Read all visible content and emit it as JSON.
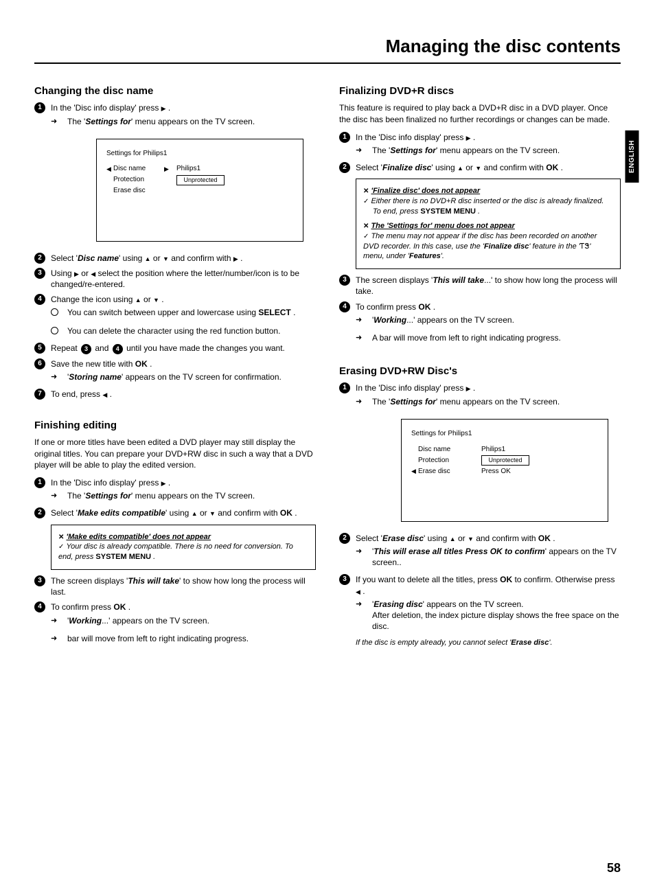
{
  "page_title": "Managing the disc contents",
  "side_tab": "ENGLISH",
  "page_number": "58",
  "sections": {
    "change_name": {
      "title": "Changing the disc name",
      "step1": "In the 'Disc info display' press ",
      "step1_result_a": "The '",
      "step1_result_b": "Settings for",
      "step1_result_c": "' menu appears on the TV screen.",
      "panel": {
        "title": "Settings for Philips1",
        "r1_key": "Disc name",
        "r1_val": "Philips1",
        "r2_key": "Protection",
        "r2_val": "Unprotected",
        "r3_key": "Erase disc"
      },
      "step2_a": "Select '",
      "step2_b": "Disc name",
      "step2_c": "' using ",
      "step2_d": " or ",
      "step2_e": " and confirm with ",
      "step3_a": "Using ",
      "step3_b": " or ",
      "step3_c": " select the position where the letter/number/icon is to be changed/re-entered.",
      "step4_a": "Change the icon using ",
      "step4_b": " or ",
      "step4_sub1_a": "You can switch between upper and lowercase using ",
      "step4_sub1_b": "SELECT",
      "step4_sub2": "You can delete the character using the red function button.",
      "step5": "Repeat ",
      "step5_mid": " and ",
      "step5_end": " until you have made the changes you want.",
      "step6_a": "Save the new title with ",
      "step6_b": "OK",
      "step6_result_a": "'",
      "step6_result_b": "Storing name",
      "step6_result_c": "' appears on the TV screen for confirmation.",
      "step7": "To end, press "
    },
    "finish_edit": {
      "title": "Finishing editing",
      "intro": "If one or more titles have been edited a DVD player may still display the original titles. You can prepare your DVD+RW disc in such a way that a DVD player will be able to play the edited version.",
      "step1": "In the 'Disc info display' press ",
      "step1_result_a": "The '",
      "step1_result_b": "Settings for",
      "step1_result_c": "' menu appears on the TV screen.",
      "step2_a": "Select '",
      "step2_b": "Make edits compatible",
      "step2_c": "' using ",
      "step2_d": " or ",
      "step2_e": " and confirm with ",
      "step2_f": "OK",
      "note_hdr": "'Make edits compatible' does not appear",
      "note_body_a": "Your disc is already compatible. There is no need for conversion. To end, press ",
      "note_body_b": "SYSTEM MENU",
      "step3_a": "The screen displays '",
      "step3_b": "This will take",
      "step3_c": "' to show how long the process will last.",
      "step4_a": "To confirm press ",
      "step4_b": "OK",
      "step4_res_a": "'",
      "step4_res_b": "Working",
      "step4_res_c": "...' appears on the TV screen.",
      "step4_res2": "bar will move from left to right indicating progress."
    },
    "finalize": {
      "title": "Finalizing DVD+R discs",
      "intro": "This feature is required to play back a DVD+R disc in a DVD player. Once the disc has been finalized no further recordings or changes can be made.",
      "step1": "In the 'Disc info display' press ",
      "step1_result_a": "The '",
      "step1_result_b": "Settings for",
      "step1_result_c": "' menu appears on the TV screen.",
      "step2_a": "Select '",
      "step2_b": "Finalize disc",
      "step2_c": "' using ",
      "step2_d": " or ",
      "step2_e": " and confirm with ",
      "step2_f": "OK",
      "note1_hdr": "'Finalize disc' does not appear",
      "note1_body": "Either there is no DVD+R disc inserted or the disc is already finalized.",
      "note1_end_a": "To end, press ",
      "note1_end_b": "SYSTEM MENU",
      "note2_hdr": "The 'Settings for' menu does not appear",
      "note2_body_a": "The menu may not appear if the disc has been recorded on another DVD recorder. In this case, use the '",
      "note2_body_b": "Finalize disc",
      "note2_body_c": "' feature in the '",
      "note2_body_d": "' menu, under '",
      "note2_body_e": "Features",
      "note2_body_f": "'.",
      "step3_a": "The screen displays '",
      "step3_b": "This will take",
      "step3_c": "...' to show how long the process will take.",
      "step4_a": "To confirm press ",
      "step4_b": "OK",
      "step4_res_a": "'",
      "step4_res_b": "Working",
      "step4_res_c": "...' appears on the TV screen.",
      "step4_res2": "A bar will move from left to right indicating progress."
    },
    "erase": {
      "title": "Erasing DVD+RW Disc's",
      "step1": "In the 'Disc info display' press ",
      "step1_result_a": "The '",
      "step1_result_b": "Settings for",
      "step1_result_c": "' menu appears on the TV screen.",
      "panel": {
        "title": "Settings for Philips1",
        "r1_key": "Disc name",
        "r1_val": "Philips1",
        "r2_key": "Protection",
        "r2_val": "Unprotected",
        "r3_key": "Erase disc",
        "r3_val": "Press OK"
      },
      "step2_a": "Select '",
      "step2_b": "Erase disc",
      "step2_c": "' using ",
      "step2_d": " or ",
      "step2_e": " and confirm with ",
      "step2_f": "OK",
      "step2_res_a": "'",
      "step2_res_b": "This will erase all titles  Press OK to confirm",
      "step2_res_c": "' appears on the TV screen..",
      "step3_a": "If you want to delete all the titles, press ",
      "step3_b": "OK",
      "step3_c": " to confirm. Otherwise press ",
      "step3_res_a": "'",
      "step3_res_b": "Erasing disc",
      "step3_res_c": "' appears on the TV screen.",
      "step3_res2": "After deletion, the index picture display shows the free space on the disc.",
      "note_a": "If the disc is empty already, you cannot select '",
      "note_b": "Erase disc",
      "note_c": "'."
    }
  }
}
